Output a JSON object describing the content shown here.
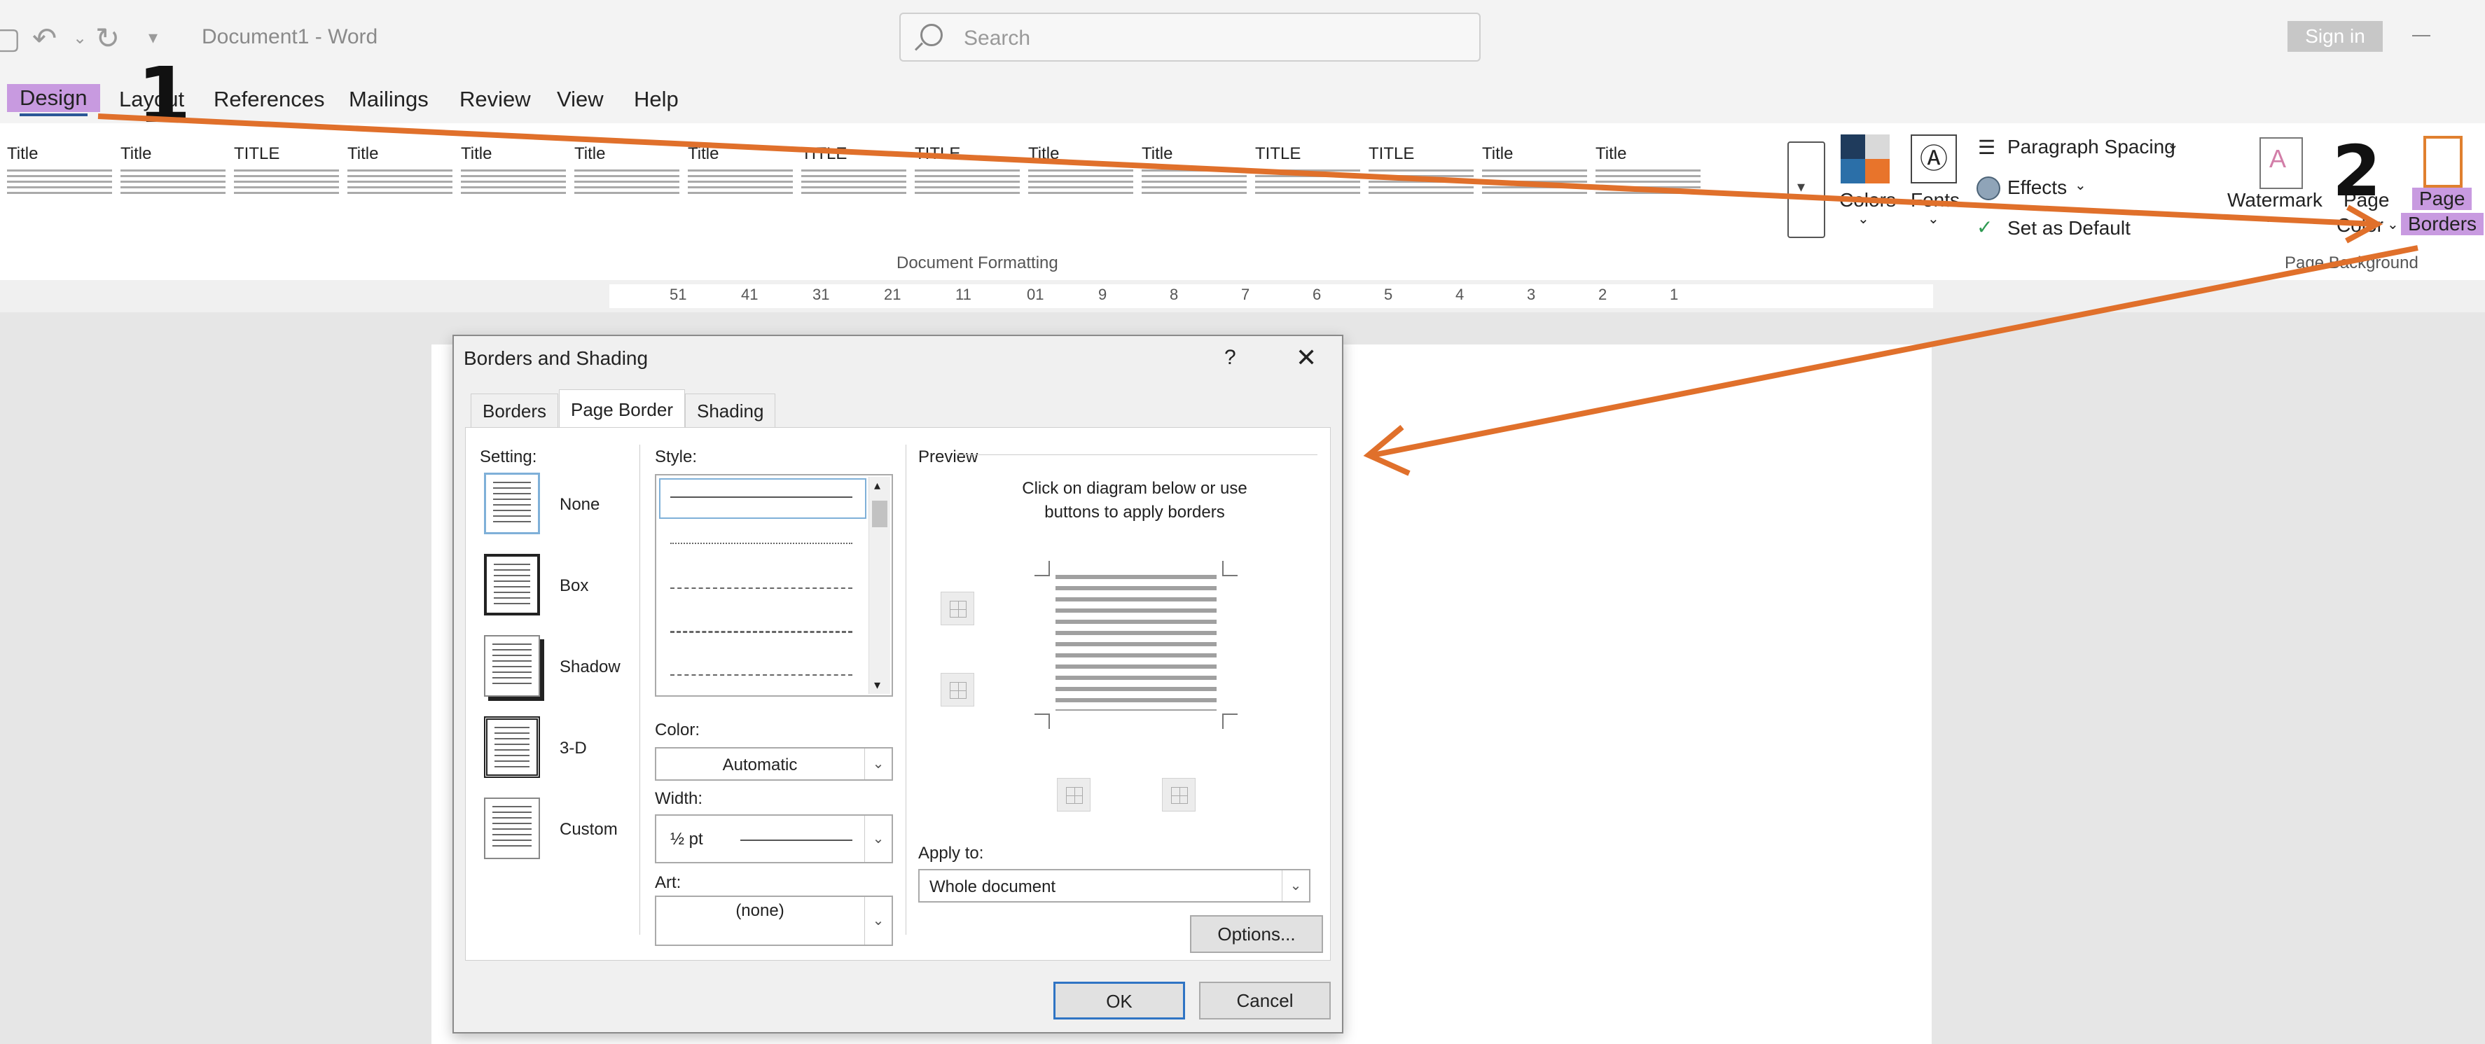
{
  "titlebar": {
    "doc_title": "Document1  -  Word",
    "search_placeholder": "Search",
    "signin_label": "Sign in"
  },
  "menu": {
    "items": [
      "Design",
      "Layout",
      "References",
      "Mailings",
      "Review",
      "View",
      "Help"
    ]
  },
  "annotations": {
    "step1": "1",
    "step2": "2",
    "arrow_color": "#e0702b"
  },
  "ribbon": {
    "style_thumbs": [
      "Title",
      "Title",
      "TITLE",
      "Title",
      "Title",
      "Title",
      "Title",
      "TITLE",
      "TITLE",
      "Title",
      "Title",
      "TITLE",
      "TITLE",
      "Title",
      "Title"
    ],
    "group_document_formatting": "Document Formatting",
    "colors_label": "Colors",
    "fonts_label": "Fonts",
    "paragraph_spacing": "Paragraph Spacing",
    "effects": "Effects",
    "set_as_default": "Set as Default",
    "watermark": "Watermark",
    "page_color_line1": "Page",
    "page_color_line2": "Color",
    "page_borders_line1": "Page",
    "page_borders_line2": "Borders",
    "group_page_background": "Page Background"
  },
  "ruler": {
    "labels": [
      "51",
      "41",
      "31",
      "21",
      "11",
      "01",
      "9",
      "8",
      "7",
      "6",
      "5",
      "4",
      "3",
      "2",
      "1"
    ]
  },
  "dialog": {
    "title": "Borders and Shading",
    "help": "?",
    "close": "✕",
    "tabs": [
      "Borders",
      "Page Border",
      "Shading"
    ],
    "setting_label": "Setting:",
    "settings": [
      "None",
      "Box",
      "Shadow",
      "3-D",
      "Custom"
    ],
    "style_label": "Style:",
    "color_label": "Color:",
    "color_value": "Automatic",
    "width_label": "Width:",
    "width_value": "½ pt",
    "art_label": "Art:",
    "art_value": "(none)",
    "preview_label": "Preview",
    "preview_hint": "Click on diagram below or use buttons to apply borders",
    "apply_to_label": "Apply to:",
    "apply_to_value": "Whole document",
    "options_button": "Options...",
    "ok_button": "OK",
    "cancel_button": "Cancel"
  }
}
